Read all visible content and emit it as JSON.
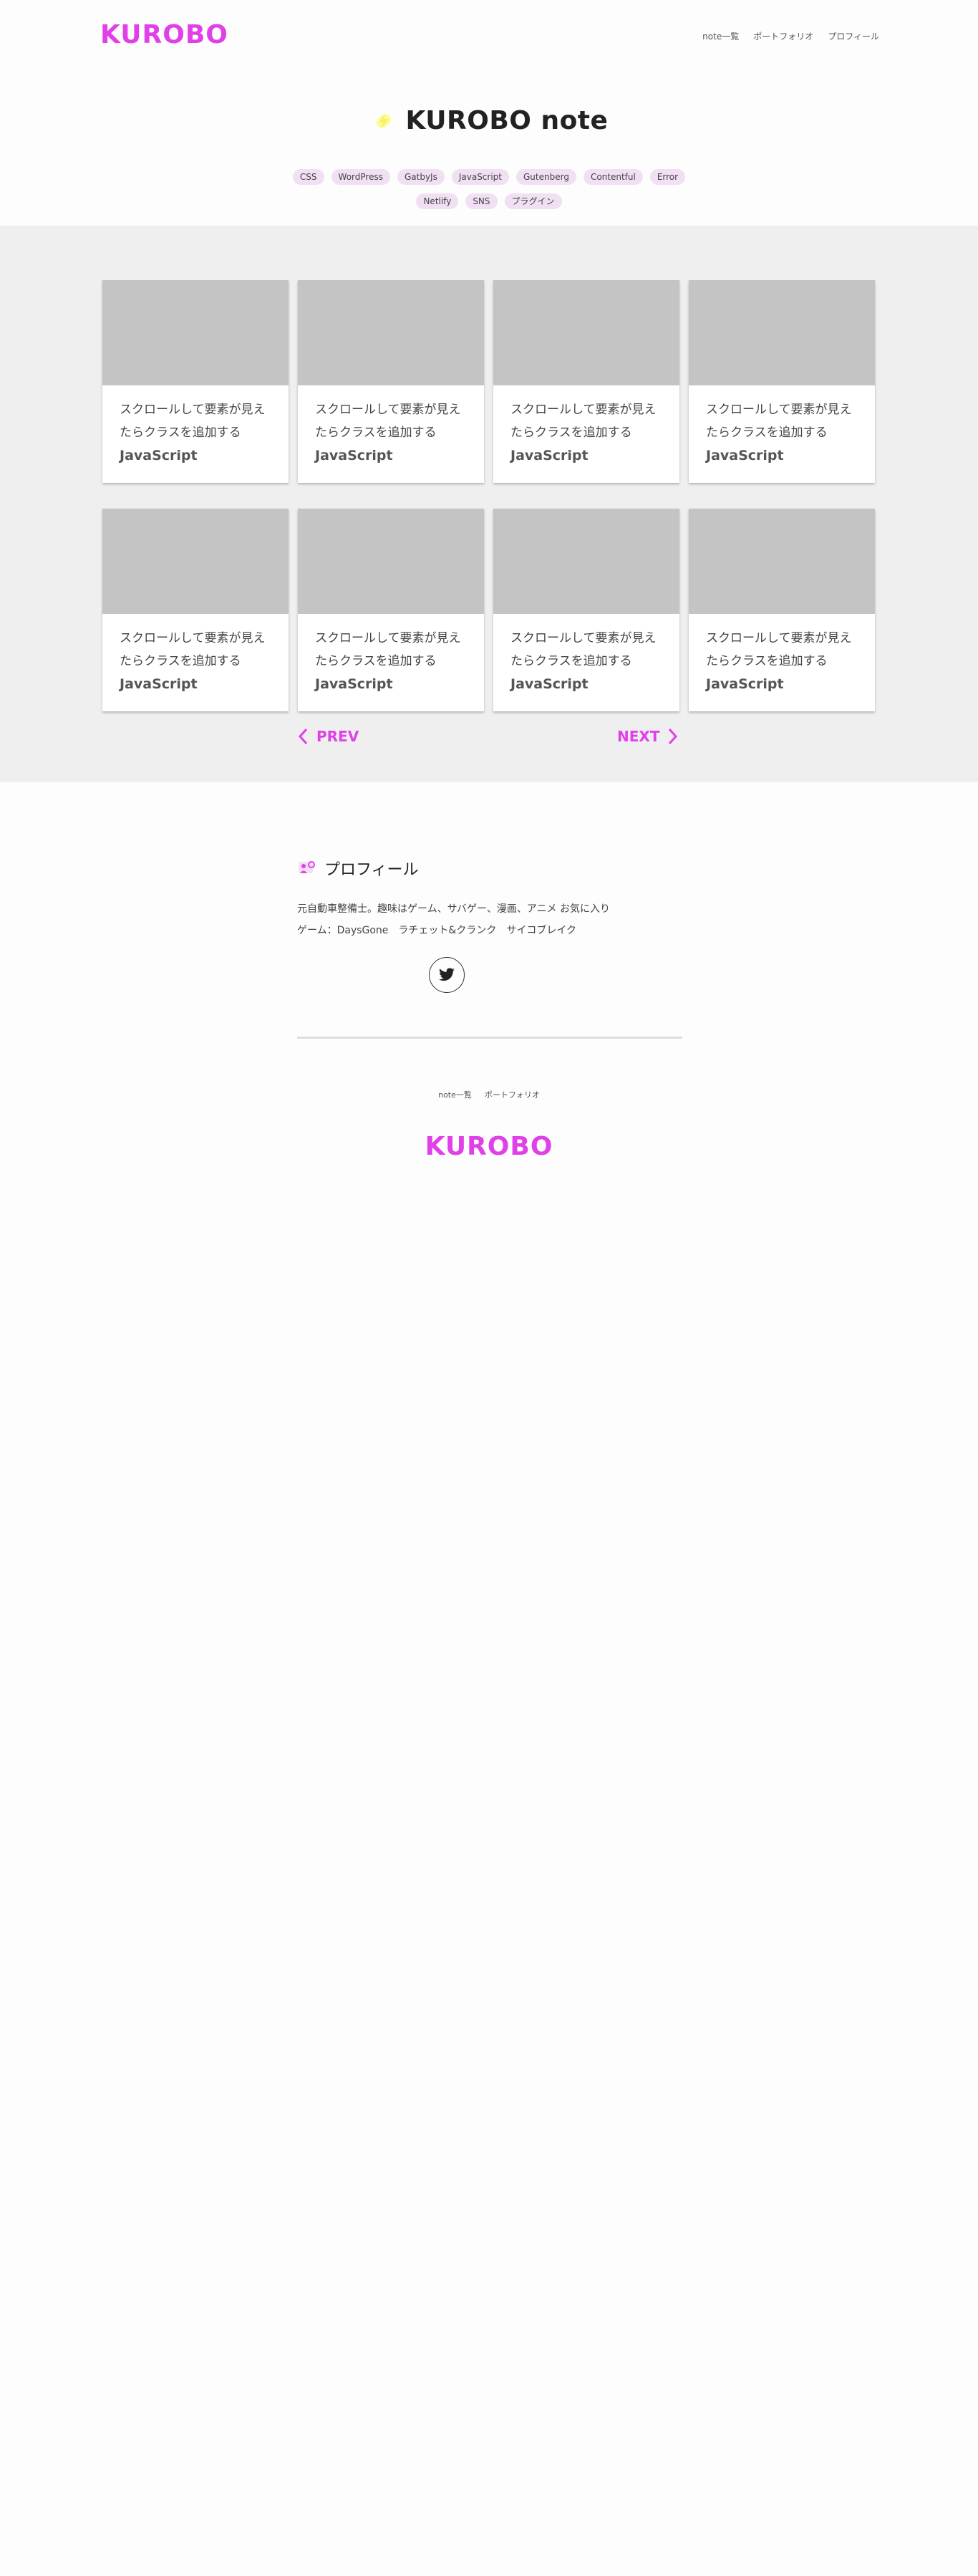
{
  "brand": {
    "logo": "KUROBO",
    "accent_color": "#e040e8"
  },
  "nav": {
    "items": [
      "note一覧",
      "ポートフォリオ",
      "プロフィール"
    ]
  },
  "hero": {
    "icon": "lightning-icon",
    "title": "KUROBO note"
  },
  "tags": [
    "CSS",
    "WordPress",
    "GatbyJs",
    "JavaScript",
    "Gutenberg",
    "Contentful",
    "Error",
    "Netlify",
    "SNS",
    "プラグイン"
  ],
  "posts": [
    {
      "title": "スクロールして要素が見えたらクラスを追加する",
      "category": "JavaScript"
    },
    {
      "title": "スクロールして要素が見えたらクラスを追加する",
      "category": "JavaScript"
    },
    {
      "title": "スクロールして要素が見えたらクラスを追加する",
      "category": "JavaScript"
    },
    {
      "title": "スクロールして要素が見えたらクラスを追加する",
      "category": "JavaScript"
    },
    {
      "title": "スクロールして要素が見えたらクラスを追加する",
      "category": "JavaScript"
    },
    {
      "title": "スクロールして要素が見えたらクラスを追加する",
      "category": "JavaScript"
    },
    {
      "title": "スクロールして要素が見えたらクラスを追加する",
      "category": "JavaScript"
    },
    {
      "title": "スクロールして要素が見えたらクラスを追加する",
      "category": "JavaScript"
    }
  ],
  "pager": {
    "prev": "PREV",
    "next": "NEXT"
  },
  "profile": {
    "icon": "profile-icon",
    "heading": "プロフィール",
    "line1": "元自動車整備士。趣味はゲーム、サバゲー、漫画、アニメ お気に入り",
    "line2": "ゲーム：DaysGone　ラチェット&クランク　サイコブレイク",
    "social_icon": "twitter-icon"
  },
  "footer": {
    "nav": [
      "note一覧",
      "ポートフォリオ"
    ],
    "logo": "KUROBO"
  }
}
